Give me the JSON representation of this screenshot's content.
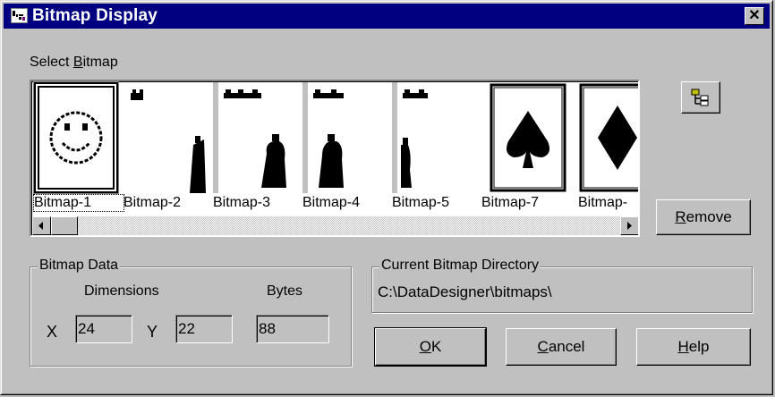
{
  "window": {
    "title": "Bitmap Display",
    "close_glyph": "✕"
  },
  "select_label": "Select Bitmap",
  "bitmaps": [
    {
      "label": "Bitmap-1",
      "kind": "smiley",
      "selected": true
    },
    {
      "label": "Bitmap-2",
      "kind": "bag"
    },
    {
      "label": "Bitmap-3",
      "kind": "bag"
    },
    {
      "label": "Bitmap-4",
      "kind": "bag"
    },
    {
      "label": "Bitmap-5",
      "kind": "bag"
    },
    {
      "label": "Bitmap-7",
      "kind": "spade"
    },
    {
      "label": "Bitmap-",
      "kind": "diamond"
    }
  ],
  "scrollbar": {
    "left_icon": "triangle-left-icon",
    "right_icon": "triangle-right-icon"
  },
  "buttons": {
    "browse_icon": "tree-directory-icon",
    "remove": "Remove",
    "ok": "OK",
    "cancel": "Cancel",
    "help": "Help"
  },
  "bitmap_data": {
    "group_title": "Bitmap Data",
    "dimensions_label": "Dimensions",
    "bytes_label": "Bytes",
    "x_label": "X",
    "x_value": "24",
    "y_label": "Y",
    "y_value": "22",
    "bytes_value": "88"
  },
  "directory": {
    "group_title": "Current Bitmap Directory",
    "path": "C:\\DataDesigner\\bitmaps\\"
  },
  "colors": {
    "title_bar": "#000080",
    "face": "#c0c0c0"
  }
}
